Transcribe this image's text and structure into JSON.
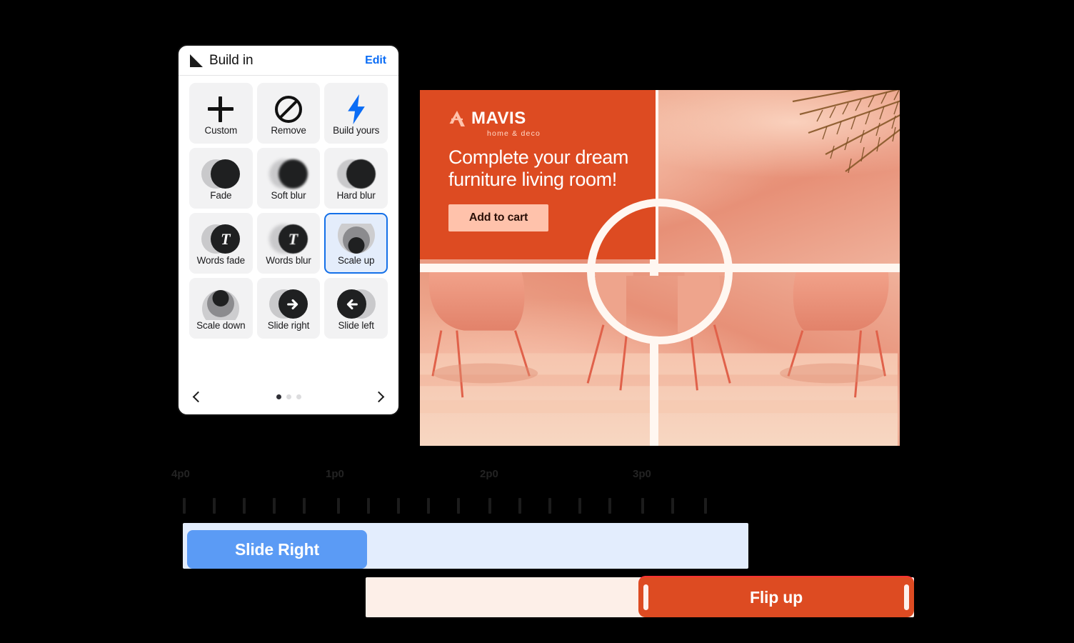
{
  "panel": {
    "title": "Build in",
    "edit_label": "Edit",
    "collapse_icon": "triangle-collapse-icon",
    "rows": [
      [
        {
          "label": "Custom",
          "icon": "plus-icon",
          "type": "plus",
          "selected": false
        },
        {
          "label": "Remove",
          "icon": "no-entry-icon",
          "type": "remove",
          "selected": false
        },
        {
          "label": "Build yours",
          "icon": "lightning-bolt-icon",
          "type": "bolt",
          "selected": false
        }
      ],
      [
        {
          "label": "Fade",
          "icon": "two-circles-icon",
          "type": "circles",
          "selected": false
        },
        {
          "label": "Soft blur",
          "icon": "two-circles-blur-icon",
          "type": "circles-soft",
          "selected": false
        },
        {
          "label": "Hard blur",
          "icon": "two-circles-hard-blur-icon",
          "type": "circles-hard",
          "selected": false
        }
      ],
      [
        {
          "label": "Words fade",
          "icon": "text-circle-icon",
          "type": "circles-t",
          "selected": false
        },
        {
          "label": "Words blur",
          "icon": "text-circle-blur-icon",
          "type": "circles-t-blur",
          "selected": false
        },
        {
          "label": "Scale up",
          "icon": "scale-up-icon",
          "type": "scale-up",
          "selected": true
        }
      ],
      [
        {
          "label": "Scale down",
          "icon": "scale-down-icon",
          "type": "scale-down",
          "selected": false
        },
        {
          "label": "Slide right",
          "icon": "arrow-right-circle-icon",
          "type": "slide-right",
          "selected": false
        },
        {
          "label": "Slide left",
          "icon": "arrow-left-circle-icon",
          "type": "slide-left",
          "selected": false
        }
      ]
    ],
    "pagination": {
      "pages": 3,
      "active_index": 0,
      "prev_icon": "chevron-left-icon",
      "next_icon": "chevron-right-icon"
    }
  },
  "canvas": {
    "promo": {
      "brand": "MAVIS",
      "tagline": "home & deco",
      "logo_icon": "mavis-a-logo-icon",
      "headline": "Complete your dream furniture living room!",
      "cta_label": "Add to cart",
      "bg_color": "#dd4b22",
      "cta_bg_color": "#ffc2ab"
    },
    "frame_color": "#fff7f1",
    "lens_icon": "circular-lens-overlay"
  },
  "timeline": {
    "ruler_labels": [
      "4p0",
      "1p0",
      "2p0",
      "3p0"
    ],
    "tracks": [
      {
        "name": "slide-right-track",
        "clip_label": "Slide Right",
        "clip_color": "#5b9bf5",
        "track_color": "#e3edfd"
      },
      {
        "name": "flip-up-track",
        "clip_label": "Flip up",
        "clip_color": "#dd4b22",
        "track_color": "#fdefe8"
      }
    ]
  }
}
